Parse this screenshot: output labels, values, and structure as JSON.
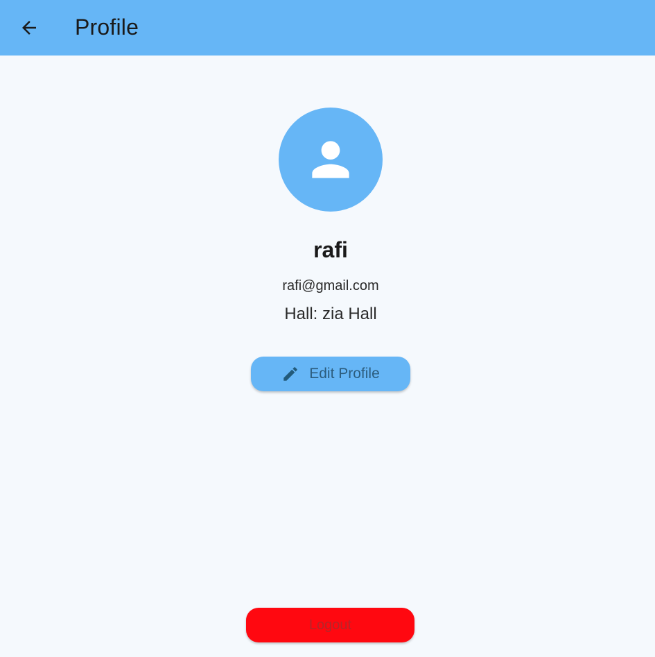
{
  "appbar": {
    "title": "Profile",
    "back_icon": "arrow-back-icon",
    "background": "#66b6f6"
  },
  "profile": {
    "avatar_icon": "person-icon",
    "name": "rafi",
    "email": "rafi@gmail.com",
    "hall": "Hall: zia Hall"
  },
  "actions": {
    "edit_label": "Edit Profile",
    "edit_icon": "pencil-icon",
    "logout_label": "Logout",
    "logout_color": "#ff0810"
  }
}
